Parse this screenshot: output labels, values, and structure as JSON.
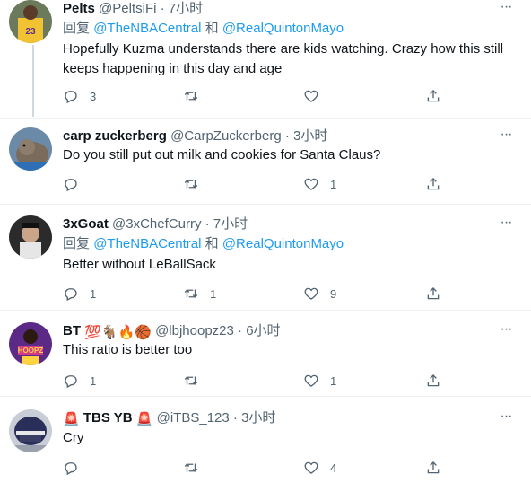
{
  "colors": {
    "link": "#1d9bf0",
    "muted": "#536471",
    "text": "#0f1419",
    "line": "#cfd9de"
  },
  "tweets": [
    {
      "name": "Pelts",
      "handle": "@PeltsiFi",
      "sep": "·",
      "time": "7小时",
      "reply_prefix": "回复",
      "reply_mention_1": "@TheNBACentral",
      "reply_and": "和",
      "reply_mention_2": "@RealQuintonMayo",
      "text": "Hopefully Kuzma understands there are kids watching. Crazy how this still keeps happening in this day and age",
      "reply_count": "3",
      "retweet_count": "",
      "like_count": "",
      "avatar_icon": "avatar-yellow-jersey"
    },
    {
      "name": "carp zuckerberg",
      "handle": "@CarpZuckerberg",
      "sep": "·",
      "time": "3小时",
      "text": "Do you still put out milk and cookies for Santa Claus?",
      "reply_count": "",
      "retweet_count": "",
      "like_count": "1",
      "avatar_icon": "avatar-seal"
    },
    {
      "name": "3xGoat",
      "handle": "@3xChefCurry",
      "sep": "·",
      "time": "7小时",
      "reply_prefix": "回复",
      "reply_mention_1": "@TheNBACentral",
      "reply_and": "和",
      "reply_mention_2": "@RealQuintonMayo",
      "text": "Better without LeBallSack",
      "reply_count": "1",
      "retweet_count": "1",
      "like_count": "9",
      "avatar_icon": "avatar-dark-portrait"
    },
    {
      "name": "BT",
      "name_emoji": "💯🐐🔥🏀",
      "handle": "@lbjhoopz23",
      "sep": "·",
      "time": "6小时",
      "text": "This ratio is better too",
      "reply_count": "1",
      "retweet_count": "",
      "like_count": "1",
      "avatar_icon": "avatar-hoopz"
    },
    {
      "name": "TBS YB",
      "name_prefix_emoji": "🚨",
      "name_suffix_emoji": "🚨",
      "handle": "@iTBS_123",
      "sep": "·",
      "time": "3小时",
      "text": "Cry",
      "reply_count": "",
      "retweet_count": "",
      "like_count": "4",
      "avatar_icon": "avatar-helmet"
    }
  ],
  "more_label": "···"
}
